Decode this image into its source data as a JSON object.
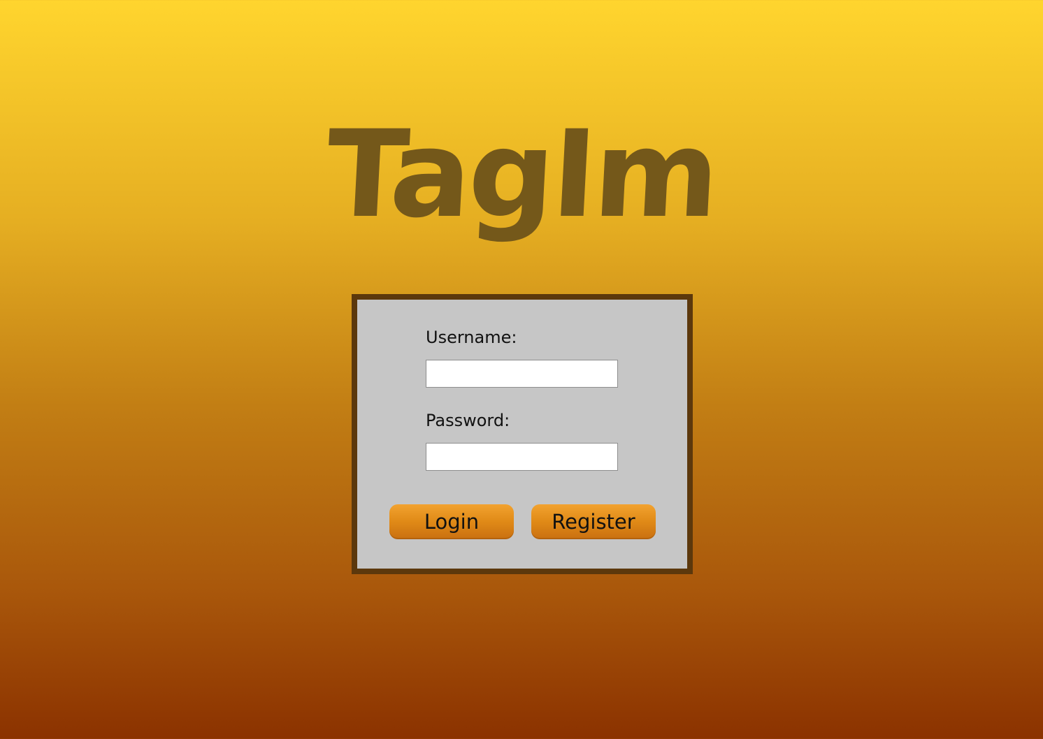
{
  "app": {
    "logo_text": "TagIm"
  },
  "login_form": {
    "username_label": "Username:",
    "username_value": "",
    "password_label": "Password:",
    "password_value": "",
    "login_button": "Login",
    "register_button": "Register"
  },
  "colors": {
    "background_top": "#FFD52E",
    "background_bottom": "#8B3200",
    "logo": "#74581A",
    "box_border": "#5C380C",
    "box_background": "#C6C6C6",
    "button": "#E08A17"
  }
}
